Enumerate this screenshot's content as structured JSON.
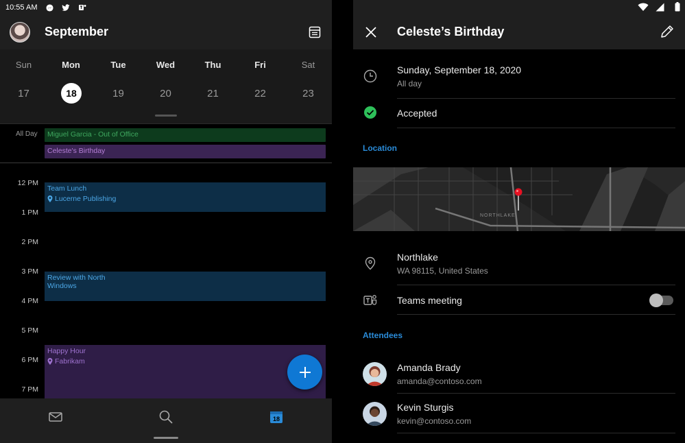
{
  "status_bar": {
    "time": "10:55 AM"
  },
  "left": {
    "month": "September",
    "week": [
      {
        "name": "Sun",
        "date": "17"
      },
      {
        "name": "Mon",
        "date": "18"
      },
      {
        "name": "Tue",
        "date": "19"
      },
      {
        "name": "Wed",
        "date": "20"
      },
      {
        "name": "Thu",
        "date": "21"
      },
      {
        "name": "Fri",
        "date": "22"
      },
      {
        "name": "Sat",
        "date": "23"
      }
    ],
    "all_day_label": "All Day",
    "all_day_events": [
      {
        "title": "Miguel Garcia - Out of Office"
      },
      {
        "title": "Celeste's Birthday"
      }
    ],
    "hours": [
      "12 PM",
      "1 PM",
      "2 PM",
      "3 PM",
      "4 PM",
      "5 PM",
      "6 PM",
      "7 PM"
    ],
    "events": {
      "lunch": {
        "title": "Team Lunch",
        "location": "Lucerne Publishing"
      },
      "review": {
        "title": "Review with North Windows"
      },
      "happy": {
        "title": "Happy Hour",
        "location": "Fabrikam"
      }
    },
    "nav_calendar_date": "18"
  },
  "right": {
    "title": "Celeste’s Birthday",
    "date": "Sunday, September 18, 2020",
    "all_day": "All day",
    "response": "Accepted",
    "location_heading": "Location",
    "map_area_label": "NORTHLAKE",
    "place_name": "Northlake",
    "place_address": "WA 98115, United States",
    "teams_label": "Teams meeting",
    "teams_enabled": false,
    "attendees_heading": "Attendees",
    "attendees": [
      {
        "name": "Amanda Brady",
        "email": "amanda@contoso.com"
      },
      {
        "name": "Kevin Sturgis",
        "email": "kevin@contoso.com"
      }
    ]
  },
  "colors": {
    "accent": "#0f78d4",
    "accepted": "#2ec05a",
    "ooo_event": "#0d3b1d",
    "birthday_event": "#3b2454",
    "blue_event": "#0d2e47",
    "purple_event": "#2f1d47"
  }
}
